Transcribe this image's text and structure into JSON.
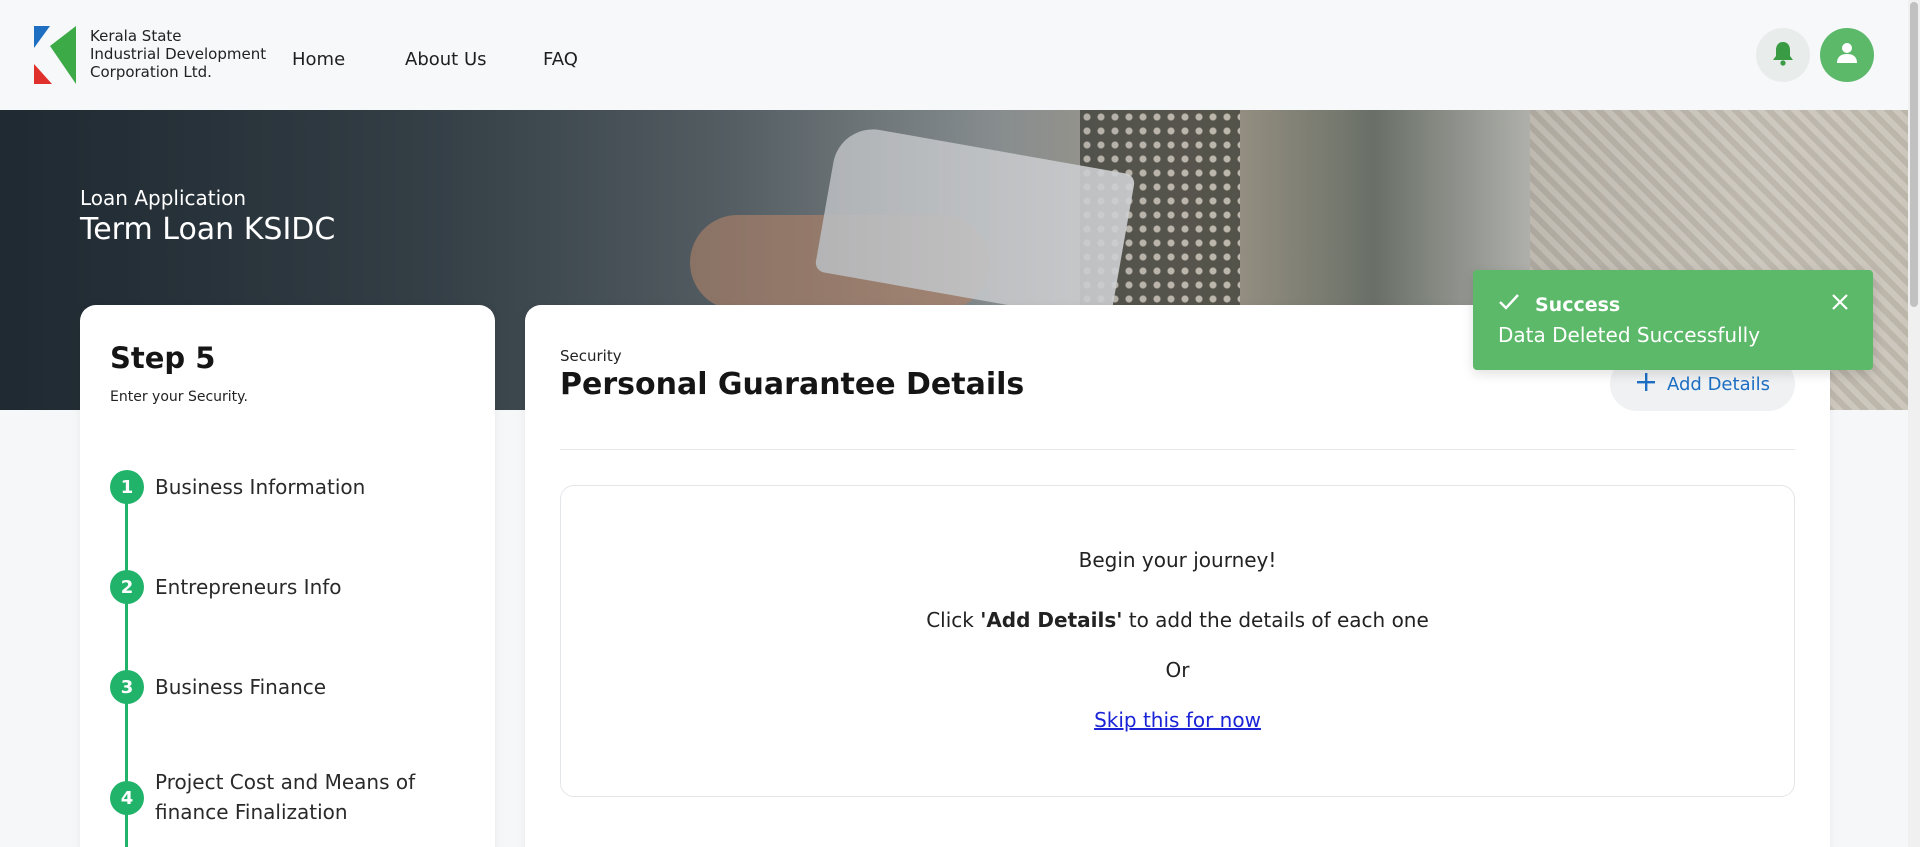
{
  "brand": {
    "line1": "Kerala State",
    "line2": "Industrial Development",
    "line3": "Corporation Ltd."
  },
  "nav": {
    "home": "Home",
    "about": "About Us",
    "faq": "FAQ"
  },
  "hero": {
    "subtitle": "Loan Application",
    "title": "Term Loan KSIDC"
  },
  "steps": {
    "title": "Step 5",
    "subtitle": "Enter your Security.",
    "items": [
      {
        "num": "1",
        "label": "Business Information"
      },
      {
        "num": "2",
        "label": "Entrepreneurs Info"
      },
      {
        "num": "3",
        "label": "Business Finance"
      },
      {
        "num": "4",
        "label": "Project Cost and Means of finance Finalization"
      }
    ]
  },
  "main": {
    "section_label": "Security",
    "section_title": "Personal Guarantee Details",
    "add_button": "Add Details",
    "empty": {
      "heading": "Begin your journey!",
      "instruction_prefix": "Click",
      "instruction_bold": "'Add Details'",
      "instruction_suffix": "to add the details of each one",
      "or": "Or",
      "skip": "Skip this for now"
    }
  },
  "toast": {
    "title": "Success",
    "message": "Data Deleted Successfully"
  },
  "colors": {
    "accent_green": "#21b36a",
    "toast_green": "#5cb96a",
    "link_blue": "#1d6fc4"
  },
  "icons": [
    "kerala-logo-icon",
    "bell-icon",
    "user-icon",
    "plus-icon",
    "check-icon",
    "close-icon"
  ]
}
